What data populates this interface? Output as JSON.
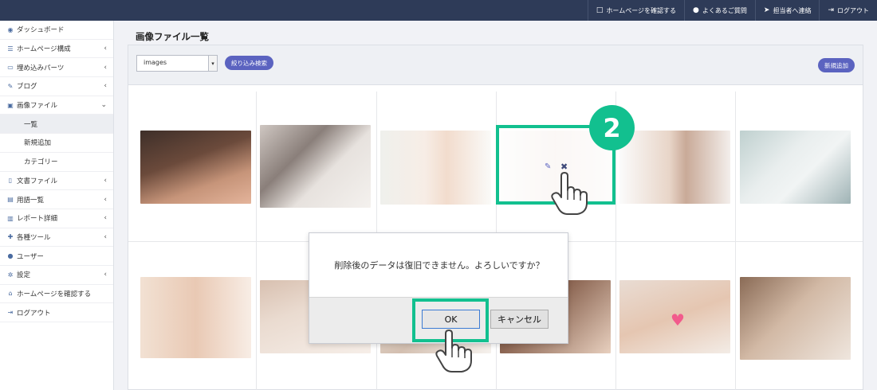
{
  "topnav": [
    {
      "icon": "□",
      "label": "ホームページを確認する"
    },
    {
      "icon": "●",
      "label": "よくあるご質問"
    },
    {
      "icon": "➤",
      "label": "担当者へ連絡"
    },
    {
      "icon": "⇥",
      "label": "ログアウト"
    }
  ],
  "sidebar": [
    {
      "icon": "◉",
      "label": "ダッシュボード",
      "chevron": ""
    },
    {
      "icon": "☰",
      "label": "ホームページ構成",
      "chevron": "‹"
    },
    {
      "icon": "▭",
      "label": "埋め込みパーツ",
      "chevron": "‹"
    },
    {
      "icon": "✎",
      "label": "ブログ",
      "chevron": "‹"
    },
    {
      "icon": "▣",
      "label": "画像ファイル",
      "chevron": "⌄"
    },
    {
      "icon": "",
      "label": "一覧",
      "chevron": ""
    },
    {
      "icon": "",
      "label": "新規追加",
      "chevron": ""
    },
    {
      "icon": "",
      "label": "カテゴリー",
      "chevron": ""
    },
    {
      "icon": "▯",
      "label": "文書ファイル",
      "chevron": "‹"
    },
    {
      "icon": "▤",
      "label": "用語一覧",
      "chevron": "‹"
    },
    {
      "icon": "▥",
      "label": "レポート詳細",
      "chevron": "‹"
    },
    {
      "icon": "✚",
      "label": "各種ツール",
      "chevron": "‹"
    },
    {
      "icon": "●",
      "label": "ユーザー",
      "chevron": ""
    },
    {
      "icon": "✲",
      "label": "設定",
      "chevron": "‹"
    },
    {
      "icon": "⌂",
      "label": "ホームページを確認する",
      "chevron": ""
    },
    {
      "icon": "⇥",
      "label": "ログアウト",
      "chevron": ""
    }
  ],
  "page": {
    "title": "画像ファイル一覧"
  },
  "toolbar": {
    "folder_value": "images",
    "filter_label": "絞り込み検索",
    "add_label": "新規追加"
  },
  "overlay": {
    "step_number": "2",
    "edit_icon": "✎",
    "delete_icon": "✖"
  },
  "dialog": {
    "message": "削除後のデータは復旧できません。よろしいですか？",
    "ok_label": "OK",
    "cancel_label": "キャンセル"
  },
  "colors": {
    "accent": "#5b63c0",
    "highlight": "#12c08f",
    "topbar": "#2e3b58"
  }
}
